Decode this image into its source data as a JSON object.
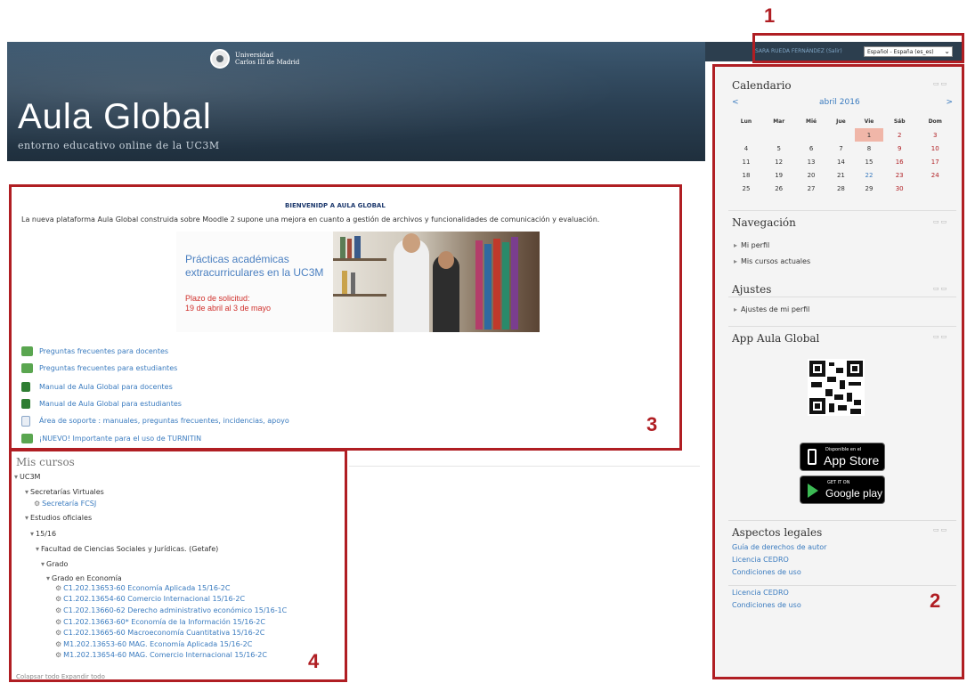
{
  "header": {
    "university_line1": "Universidad",
    "university_line2": "Carlos III de Madrid",
    "title": "Aula Global",
    "subtitle": "entorno educativo online de la UC3M"
  },
  "userbar": {
    "user_link": "SARA RUEDA FERNÁNDEZ (Salir)",
    "language": "Español - España (es_es)"
  },
  "callouts": [
    "1",
    "2",
    "3",
    "4"
  ],
  "calendar": {
    "title": "Calendario",
    "prev": "<",
    "next": ">",
    "month": "abril 2016",
    "weekdays": [
      "Lun",
      "Mar",
      "Mié",
      "Jue",
      "Vie",
      "Sáb",
      "Dom"
    ],
    "weeks": [
      [
        "",
        "",
        "",
        "",
        "1",
        "2",
        "3"
      ],
      [
        "4",
        "5",
        "6",
        "7",
        "8",
        "9",
        "10"
      ],
      [
        "11",
        "12",
        "13",
        "14",
        "15",
        "16",
        "17"
      ],
      [
        "18",
        "19",
        "20",
        "21",
        "22",
        "23",
        "24"
      ],
      [
        "25",
        "26",
        "27",
        "28",
        "29",
        "30",
        ""
      ]
    ]
  },
  "navigation": {
    "title": "Navegación",
    "items": [
      "Mi perfil",
      "Mis cursos actuales"
    ]
  },
  "settings": {
    "title": "Ajustes",
    "items": [
      "Ajustes de mi perfil"
    ]
  },
  "app": {
    "title": "App Aula Global",
    "appstore_small": "Disponible en el",
    "appstore_big": "App Store",
    "googleplay_small": "GET IT ON",
    "googleplay_big": "Google play"
  },
  "legal": {
    "title": "Aspectos legales",
    "items": [
      "Guía de derechos de autor",
      "Licencia CEDRO",
      "Condiciones de uso"
    ],
    "items2": [
      "Licencia CEDRO",
      "Condiciones de uso"
    ]
  },
  "main": {
    "welcome_title": "BIENVENIDP A AULA GLOBAL",
    "welcome_text": "La nueva plataforma Aula Global construida sobre Moodle 2 supone una mejora en cuanto a gestión de archivos y funcionalidades de comunicación y evaluación.",
    "promo_line1": "Prácticas académicas",
    "promo_line2": "extracurriculares en la UC3M",
    "promo_line3": "Plazo de solicitud:",
    "promo_line4": "19 de abril al 3 de mayo",
    "resources": [
      "Preguntas frecuentes para docentes",
      "Preguntas frecuentes para estudiantes",
      "Manual de Aula Global para docentes",
      "Manual de Aula Global para estudiantes",
      "Área de soporte : manuales, preguntas frecuentes, incidencias, apoyo",
      "¡NUEVO! Importante para el uso de TURNITIN"
    ]
  },
  "courses": {
    "title": "Mis cursos",
    "tree": [
      "UC3M",
      "Secretarías Virtuales",
      "Estudios oficiales",
      "15/16",
      "Facultad de Ciencias Sociales y Jurídicas. (Getafe)",
      "Grado",
      "Grado en Economía"
    ],
    "secretaria": "Secretaría FCSJ",
    "list": [
      "C1.202.13653-60 Economía Aplicada 15/16-2C",
      "C1.202.13654-60 Comercio Internacional 15/16-2C",
      "C1.202.13660-62 Derecho administrativo económico 15/16-1C",
      "C1.202.13663-60* Economía de la Información 15/16-2C",
      "C1.202.13665-60 Macroeconomía Cuantitativa 15/16-2C",
      "M1.202.13653-60 MAG. Economía Aplicada 15/16-2C",
      "M1.202.13654-60 MAG. Comercio Internacional 15/16-2C"
    ],
    "footer": "Colapsar todo Expandir todo"
  }
}
